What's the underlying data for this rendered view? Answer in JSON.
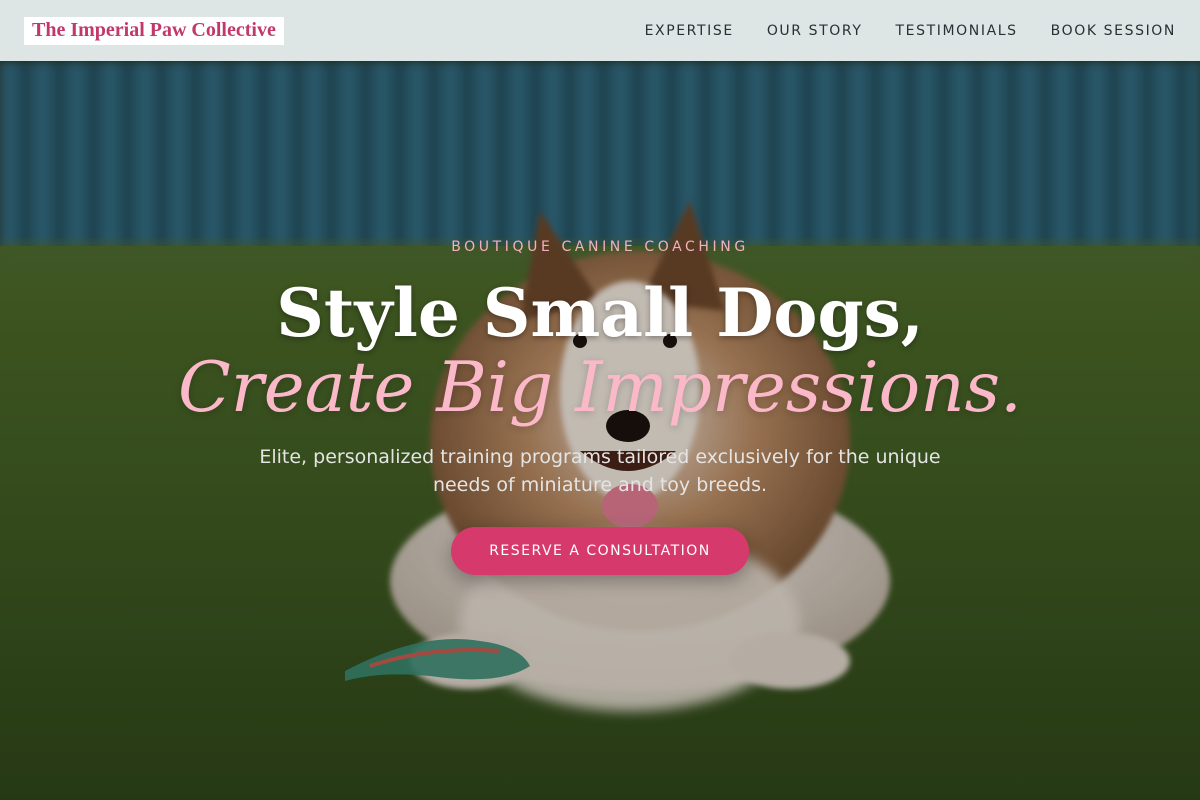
{
  "header": {
    "brand": "The Imperial Paw Collective",
    "nav": [
      {
        "label": "EXPERTISE"
      },
      {
        "label": "OUR STORY"
      },
      {
        "label": "TESTIMONIALS"
      },
      {
        "label": "BOOK SESSION"
      }
    ]
  },
  "hero": {
    "eyebrow": "BOUTIQUE CANINE COACHING",
    "headline_line1": "Style Small Dogs,",
    "headline_line2": "Create Big Impressions.",
    "subtext": "Elite, personalized training programs tailored exclusively for the unique needs of miniature and toy breeds.",
    "cta_label": "RESERVE A CONSULTATION"
  },
  "colors": {
    "brand_pink": "#c2386b",
    "accent_pink": "#d63a6c",
    "headline_pink": "#fbb8c9",
    "header_bg": "#dde6e5",
    "grass_green": "#3f5a22"
  }
}
